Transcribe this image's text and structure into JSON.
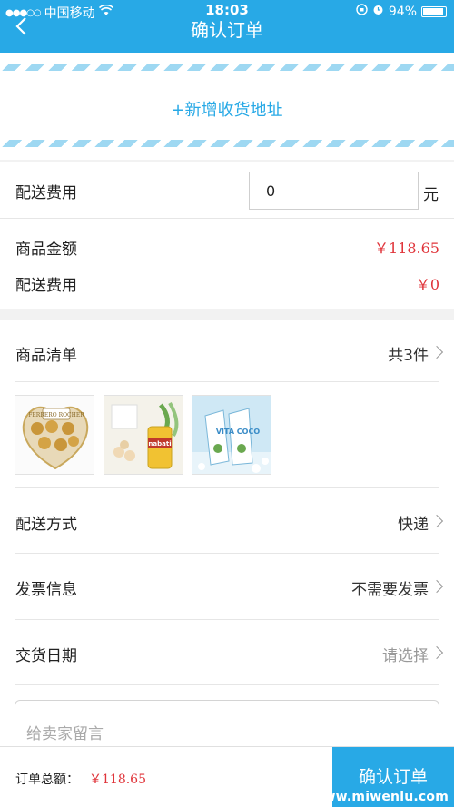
{
  "statusbar": {
    "carrier": "中国移动",
    "time": "18:03",
    "battery": "94%"
  },
  "header": {
    "title": "确认订单"
  },
  "address": {
    "add_label": "+新增收货地址"
  },
  "fee": {
    "delivery_fee_label": "配送费用",
    "delivery_fee_value": "0",
    "unit": "元",
    "goods_amount_label": "商品金额",
    "goods_amount_value": "￥118.65",
    "shipping_label": "配送费用",
    "shipping_value": "￥0"
  },
  "order": {
    "list_label": "商品清单",
    "list_count": "共3件",
    "products": [
      {
        "name": "FERRERO ROCHER",
        "caption": "FERRERO ROCHER"
      },
      {
        "name": "nabati",
        "caption": "nabati"
      },
      {
        "name": "VITA COCO",
        "caption": "VITA COCO"
      }
    ],
    "delivery_method_label": "配送方式",
    "delivery_method_value": "快递",
    "invoice_label": "发票信息",
    "invoice_value": "不需要发票",
    "date_label": "交货日期",
    "date_value": "请选择",
    "message_placeholder": "给卖家留言"
  },
  "bottom": {
    "total_label": "订单总额：",
    "total_value": "￥118.65",
    "confirm_label": "确认订单"
  },
  "watermark": "www.miwenlu.com",
  "colors": {
    "brand": "#28a9e6",
    "price": "#e0353b"
  }
}
